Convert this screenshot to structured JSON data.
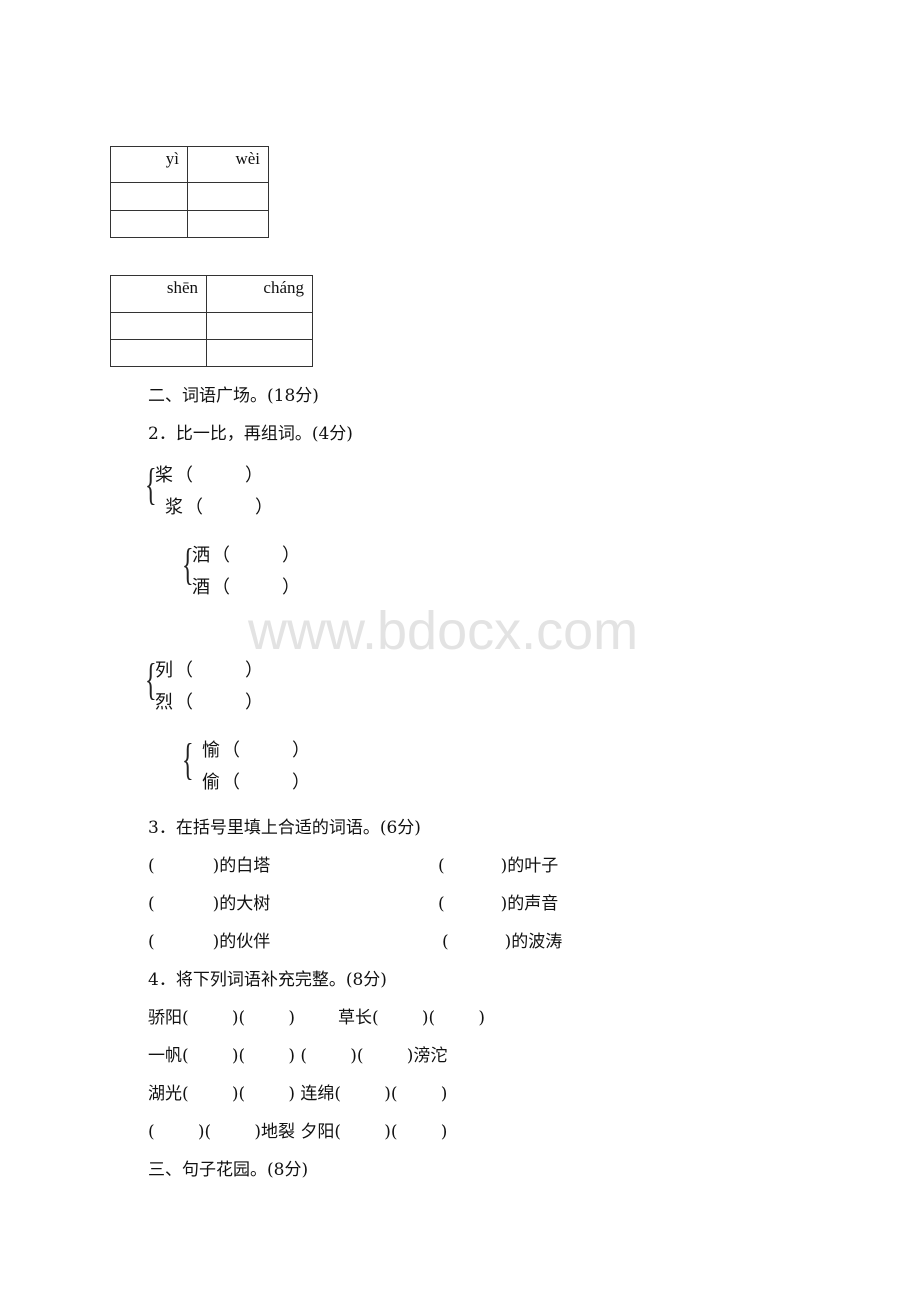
{
  "pinyin_tables": [
    {
      "headers": [
        "yì",
        "wèi"
      ]
    },
    {
      "headers": [
        "shēn",
        "cháng"
      ]
    }
  ],
  "section2": {
    "title": "二、词语广场。(18分)",
    "q2": {
      "title": "2．比一比，再组词。(4分)",
      "pairs": [
        [
          "桨",
          "浆"
        ],
        [
          "洒",
          "酒"
        ],
        [
          "列",
          "烈"
        ],
        [
          "愉",
          "偷"
        ]
      ],
      "paren_open": "（",
      "paren_close": "）"
    },
    "q3": {
      "title": "3．在括号里填上合适的词语。(6分)",
      "items": [
        [
          "(",
          ")的白塔",
          "(",
          ")的叶子"
        ],
        [
          "(",
          ")的大树",
          "(",
          ")的声音"
        ],
        [
          "(",
          ")的伙伴",
          "(",
          ")的波涛"
        ]
      ]
    },
    "q4": {
      "title": "4．将下列词语补充完整。(8分)",
      "rows": [
        [
          "骄阳(        )(        )",
          "草长(        )(        )"
        ],
        [
          "一帆(        )(        ) (        )(        )滂沱"
        ],
        [
          "湖光(        )(        ) 连绵(        )(        )"
        ],
        [
          "(        )(        )地裂 夕阳(        )(        )"
        ]
      ]
    }
  },
  "section3": {
    "title": "三、句子花园。(8分)"
  },
  "watermark": "www.bdocx.com"
}
